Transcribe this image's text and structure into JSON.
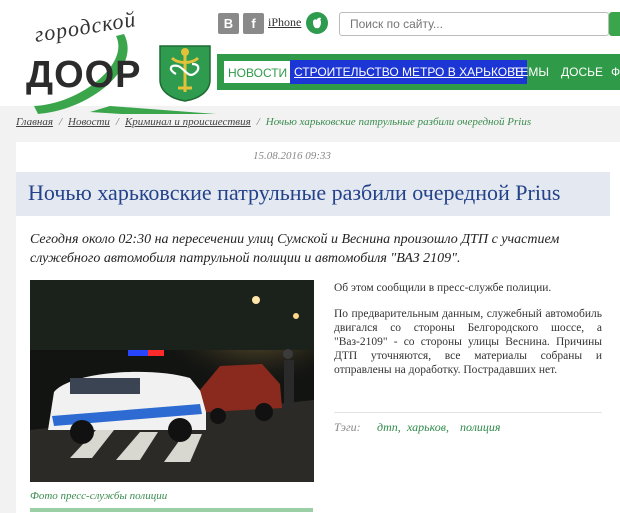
{
  "header": {
    "logo_script": "городской",
    "logo_main": "ДООР",
    "social": {
      "vk": "B",
      "facebook": "f",
      "iphone": "iPhone"
    },
    "search_placeholder": "Поиск по сайту..."
  },
  "nav": {
    "items": [
      "НОВОСТИ",
      "СТРОИТЕЛЬСТВО МЕТРО В ХАРЬКОВЕ",
      "ТЕМЫ",
      "ДОСЬЕ",
      "Ф"
    ]
  },
  "breadcrumbs": {
    "items": [
      "Главная",
      "Новости",
      "Криминал и происшествия"
    ],
    "current": "Ночью харьковские патрульные разбили очередной Prius"
  },
  "article": {
    "date": "15.08.2016  09:33",
    "title": "Ночью харьковские патрульные разбили очередной Prius",
    "lead": "Сегодня около 02:30 на пересечении улиц Сумской и Веснина произошло ДТП с участием служебного автомобиля патрульной полиции и автомобиля \"ВАЗ 2109\".",
    "p1": "Об этом сообщили в пресс-службе полиции.",
    "p2": "По предварительным данным, служебный автомобиль двигался со стороны Белгородского шоссе, а \"Ваз-2109\" - со стороны улицы Веснина. Причины ДТП уточняются, все материалы собраны и отправлены на доработку. Пострадавших нет.",
    "photo_caption": "Фото пресс-службы полиции",
    "tags_label": "Тэги:",
    "tags": [
      "дтп,",
      "харьков,",
      "полиция"
    ]
  },
  "colors": {
    "brand_green": "#2f9b48",
    "metro_blue": "#1c36d6",
    "title_blue": "#24428a"
  }
}
